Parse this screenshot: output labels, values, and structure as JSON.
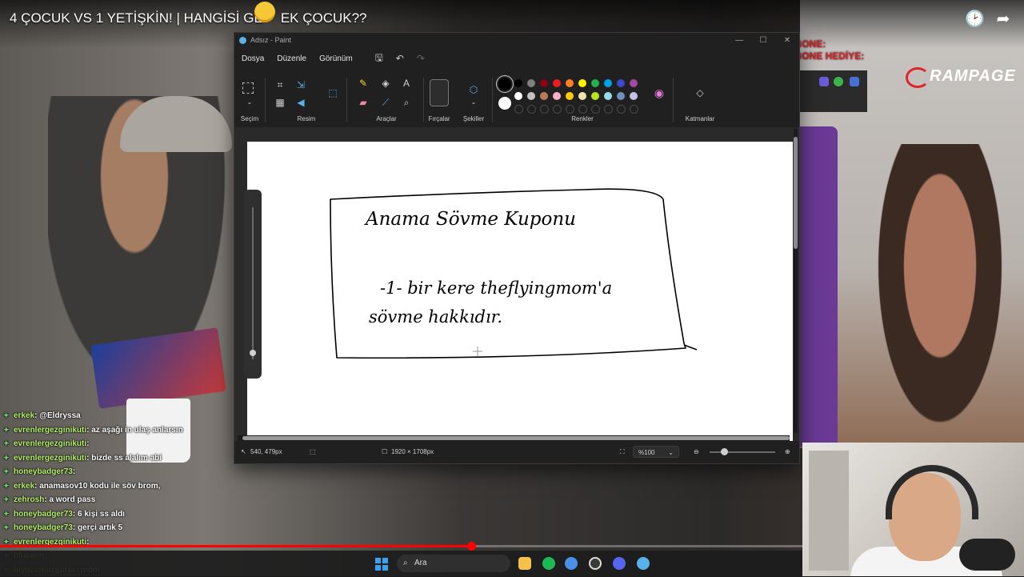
{
  "video": {
    "title_left": "4 ÇOCUK VS 1 YETİŞKİN! | HANGİSİ GE",
    "title_right": "EK ÇOCUK??",
    "brand": "RAMPAGE",
    "overlay_line1": "SON ABONE:",
    "overlay_line2": "SON ABONE HEDİYE:",
    "progress": 0.587
  },
  "paint": {
    "window_title": "Adsız - Paint",
    "menu": [
      "Dosya",
      "Düzenle",
      "Görünüm"
    ],
    "groups": {
      "selection": "Seçim",
      "image": "Resim",
      "tools": "Araçlar",
      "brushes": "Fırçalar",
      "shapes": "Şekiller",
      "colors": "Renkler",
      "layers": "Katmanlar"
    },
    "colors": {
      "primary": "#000000",
      "secondary": "#ffffff",
      "row1": [
        "#000000",
        "#7f7f7f",
        "#880015",
        "#ed1c24",
        "#ff7f27",
        "#fff200",
        "#22b14c",
        "#00a2e8",
        "#3f48cc",
        "#a349a4"
      ],
      "row2": [
        "#ffffff",
        "#c3c3c3",
        "#b97a57",
        "#ffaec9",
        "#ffc90e",
        "#efe4b0",
        "#b5e61d",
        "#99d9ea",
        "#7092be",
        "#c8bfe7"
      ]
    },
    "drawing": {
      "line1": "Anama   Sövme   Kuponu",
      "line2": "-1-  bir  kere  theflyingmom'a",
      "line3": "sövme  hakkıdır."
    },
    "status": {
      "cursor": "540, 479px",
      "canvas_size": "1920 × 1708px",
      "zoom": "%100"
    }
  },
  "chat": [
    {
      "user": "erkek",
      "msg": ": @Eldryssa"
    },
    {
      "user": "evrenlergezginikuti",
      "msg": ": az aşağı in ulaş anlarsın"
    },
    {
      "user": "evrenlergezginikuti",
      "msg": ":"
    },
    {
      "user": "evrenlergezginikuti",
      "msg": ": bizde ss alalım abi"
    },
    {
      "user": "honeybadger73",
      "msg": ":"
    },
    {
      "user": "erkek",
      "msg": ": anamasov10 kodu ile söv brom,"
    },
    {
      "user": "zehrosh",
      "msg": ": a word pass"
    },
    {
      "user": "honeybadger73",
      "msg": ": 6 kişi ss aldı"
    },
    {
      "user": "honeybadger73",
      "msg": ": gerçi artık 5"
    },
    {
      "user": "evrenlergezginikuti",
      "msg": ":"
    },
    {
      "user": "blueaeri",
      "msg": ":"
    },
    {
      "user": "biyuzumuzgulse",
      "msg": ": mom"
    }
  ],
  "taskbar": {
    "search_placeholder": "Ara"
  }
}
